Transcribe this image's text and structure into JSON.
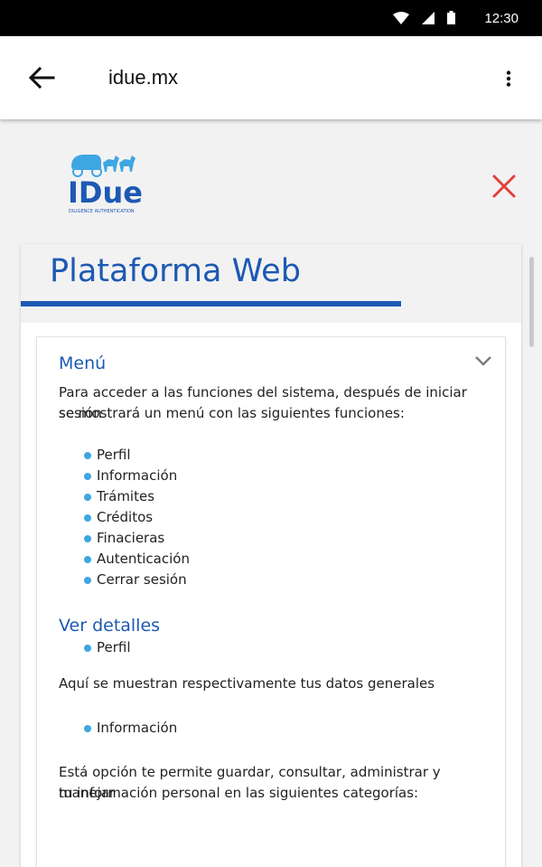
{
  "status_bar": {
    "time": "12:30"
  },
  "app_bar": {
    "title": "idue.mx"
  },
  "logo": {
    "text": "IDue",
    "tagline": "DILIGENCE AUTHENTICATION"
  },
  "card": {
    "title": "Plataforma Web",
    "menu_section": {
      "heading": "Menú",
      "intro_line1": "Para acceder a las funciones del sistema, después de iniciar sesión",
      "intro_line2": "se mostrará un menú con las siguientes  funciones:",
      "items": [
        "Perfil",
        "Información",
        "Trámites",
        "Créditos",
        "Finacieras",
        "Autenticación",
        "Cerrar sesión"
      ]
    },
    "details_section": {
      "heading": "Ver detalles",
      "item1": "Perfil",
      "desc1": "Aquí se muestran respectivamente tus datos generales",
      "item2": "Información",
      "desc2_line1": "Está opción te permite guardar, consultar, administrar y manejar",
      "desc2_line2": "tu información personal en las siguientes categorías:"
    }
  },
  "colors": {
    "accent": "#1d59b4",
    "bullet": "#3ea6e2",
    "close": "#e0413a"
  }
}
